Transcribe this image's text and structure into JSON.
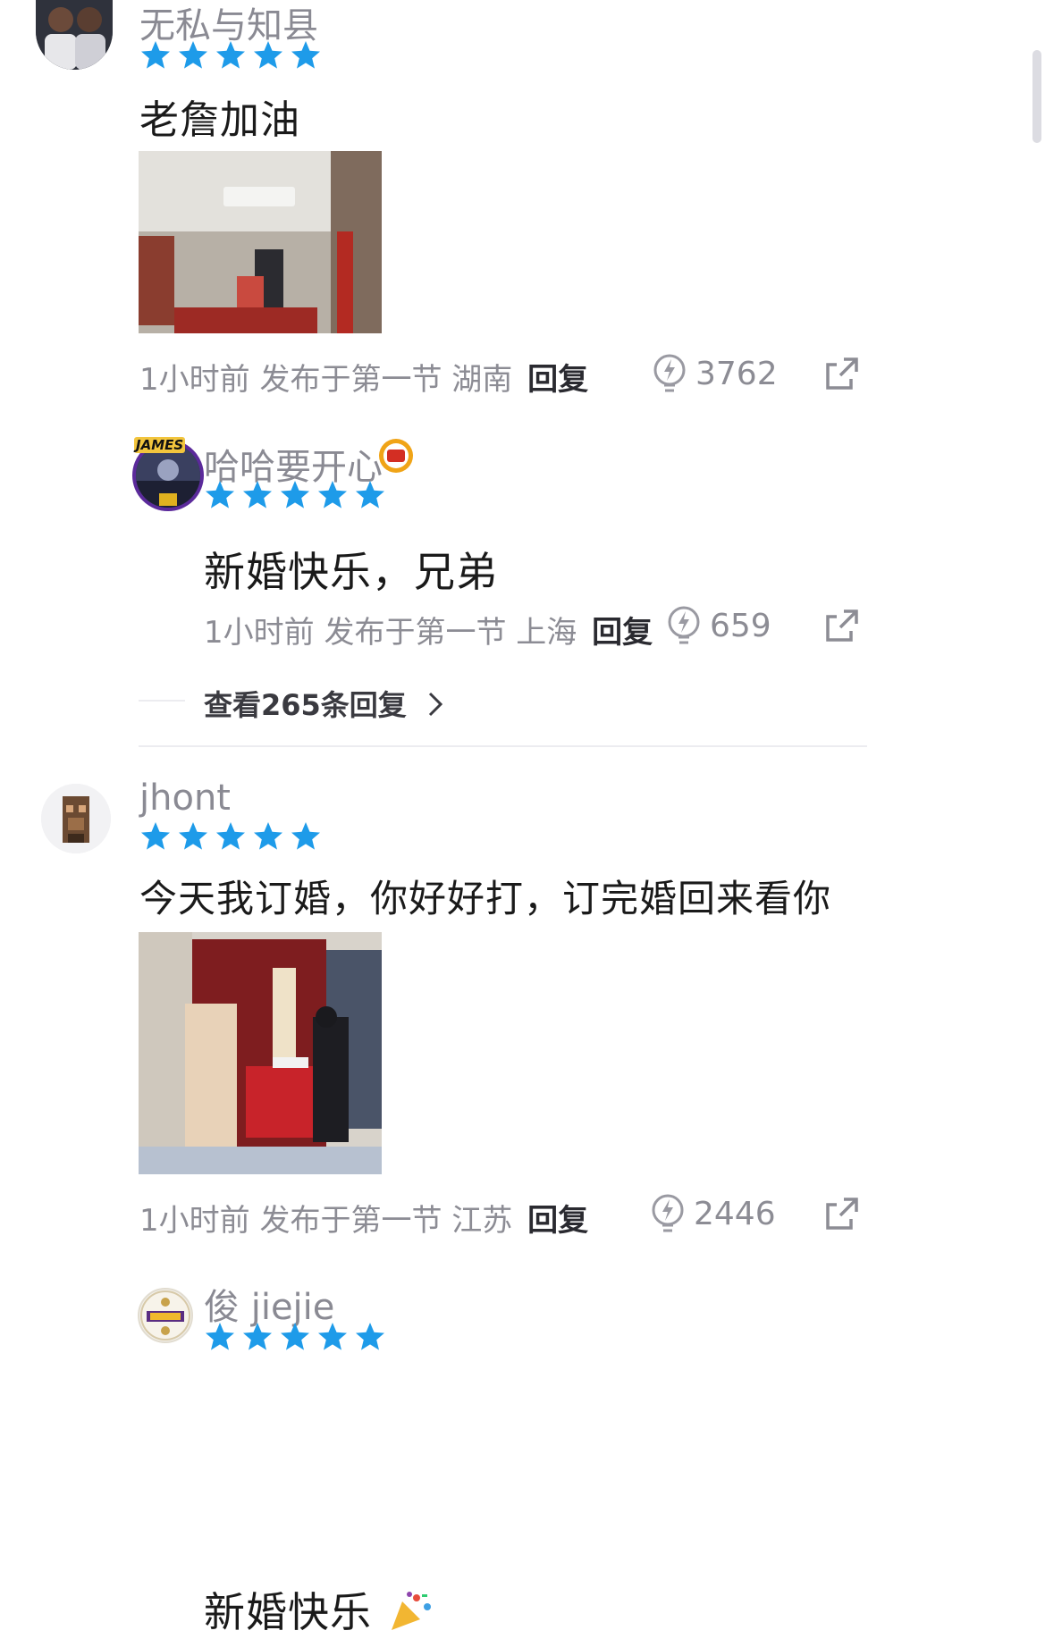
{
  "comments": [
    {
      "username": "无私与知县",
      "rating": 5,
      "content": "老詹加油",
      "meta": {
        "time": "1小时前",
        "section": "发布于第一节",
        "region": "湖南",
        "reply_label": "回复"
      },
      "likes": "3762"
    },
    {
      "username": "哈哈要开心",
      "avatar_text": "JAMES",
      "rating": 5,
      "content": "新婚快乐，兄弟",
      "meta": {
        "time": "1小时前",
        "section": "发布于第一节",
        "region": "上海",
        "reply_label": "回复"
      },
      "likes": "659"
    },
    {
      "username": "jhont",
      "rating": 5,
      "content": "今天我订婚，你好好打，订完婚回来看你",
      "meta": {
        "time": "1小时前",
        "section": "发布于第一节",
        "region": "江苏",
        "reply_label": "回复"
      },
      "likes": "2446"
    },
    {
      "username": "俊 jiejie",
      "rating": 5,
      "content": "新婚快乐"
    }
  ],
  "view_replies": "查看265条回复",
  "icons": {
    "star": "star-icon",
    "like": "lightning-bulb-icon",
    "share": "share-icon",
    "chevron": "chevron-right-icon"
  },
  "colors": {
    "star": "#1e9be9",
    "meta": "#8c8c94",
    "content": "#1a1a1a",
    "divider": "#ececf0"
  }
}
